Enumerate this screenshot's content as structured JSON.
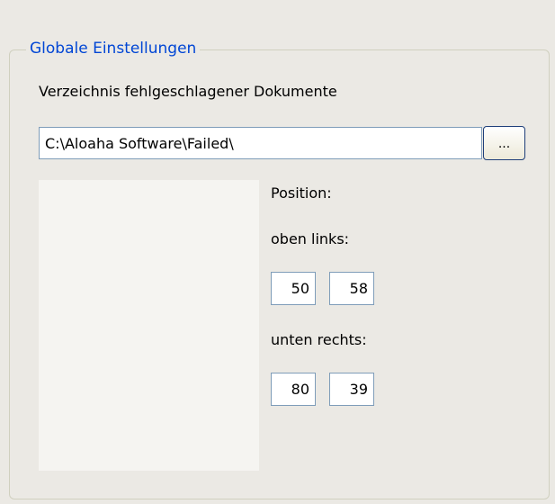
{
  "group": {
    "title": "Globale Einstellungen"
  },
  "failed_docs": {
    "label": "Verzeichnis fehlgeschlagener Dokumente",
    "path_value": "C:\\Aloaha Software\\Failed\\",
    "browse_label": "..."
  },
  "position": {
    "label": "Position:",
    "top_left_label": "oben links:",
    "top_left_x": "50",
    "top_left_y": "58",
    "bottom_right_label": "unten rechts:",
    "bottom_right_x": "80",
    "bottom_right_y": "39"
  },
  "colors": {
    "background": "#ebe9e4",
    "group_title": "#0046d5",
    "field_border": "#7f9db9",
    "preview_background": "#f5f4f1"
  }
}
